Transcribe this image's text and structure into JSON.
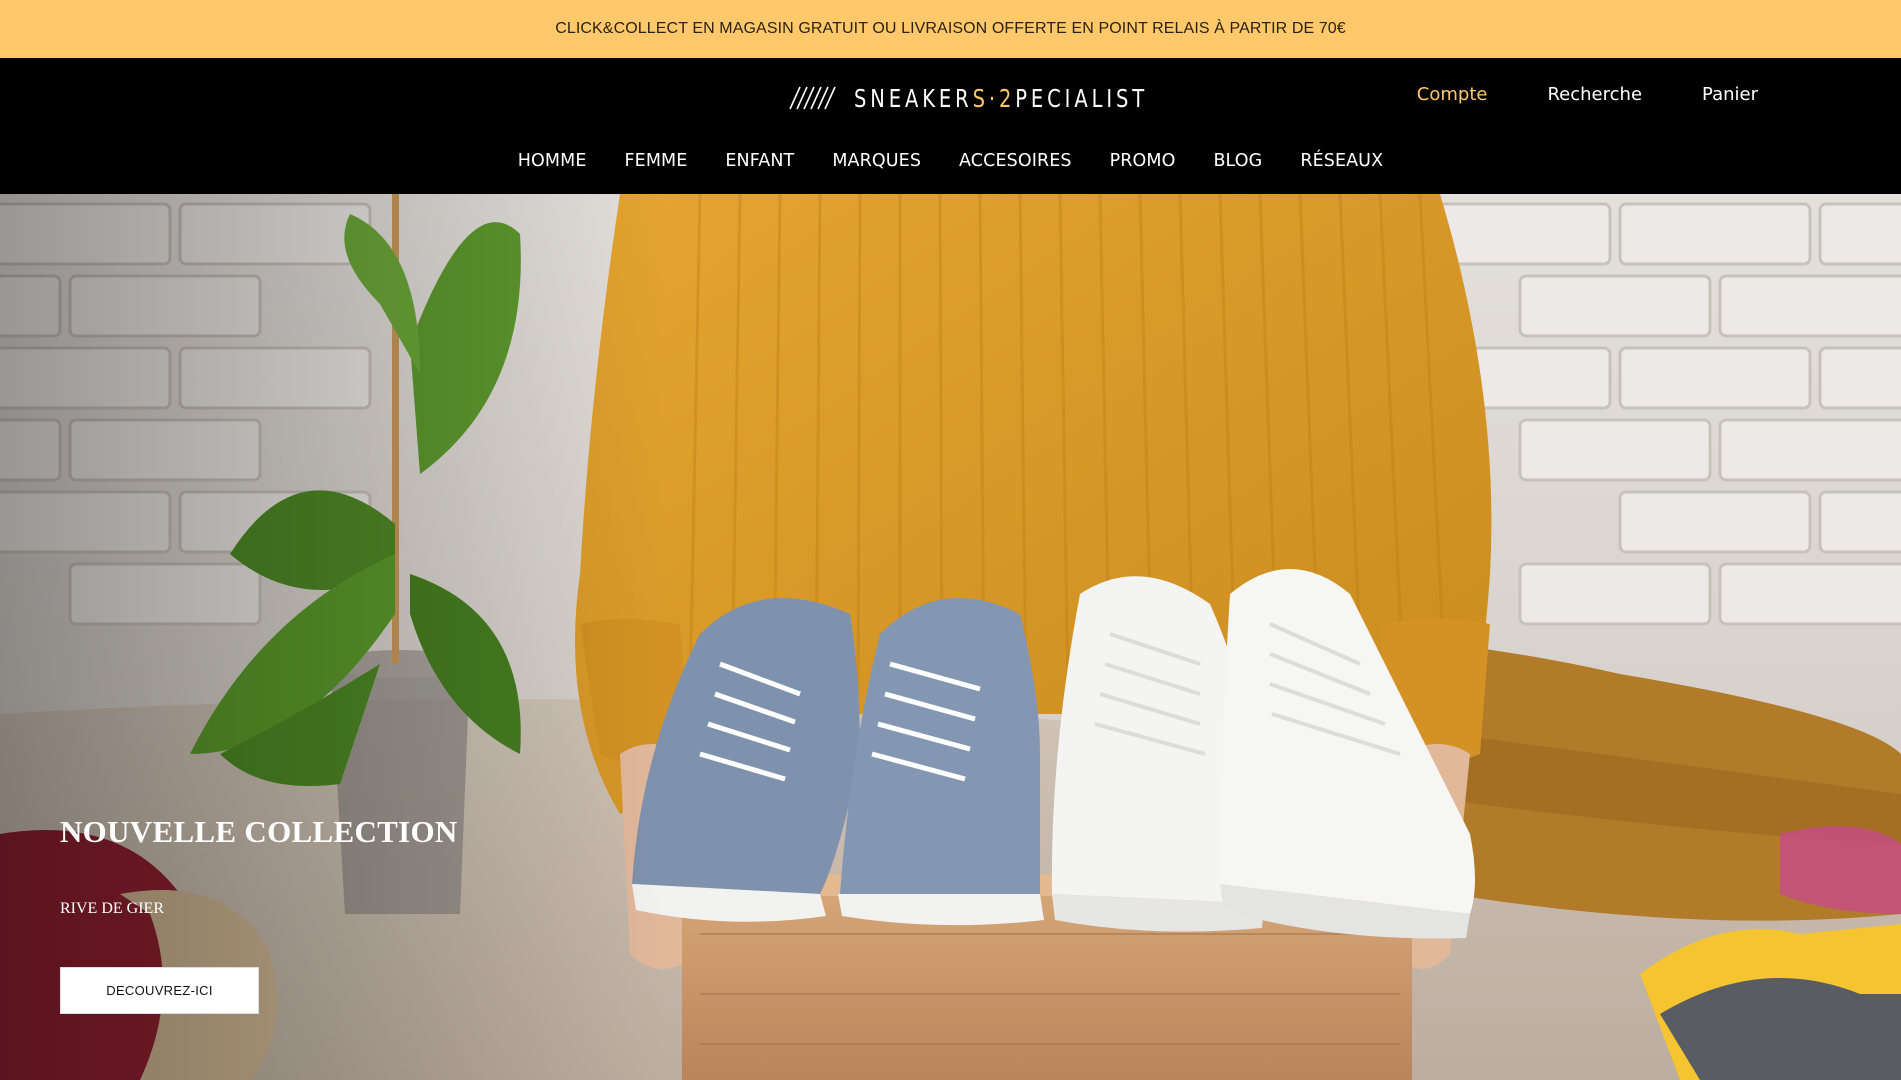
{
  "announcement": {
    "text": "CLICK&COLLECT EN MAGASIN GRATUIT OU LIVRAISON OFFERTE EN POINT RELAIS À PARTIR DE 70€"
  },
  "logo": {
    "text_main": "SNEAKER",
    "text_accent": "S·2",
    "text_end": "PECIALIST"
  },
  "account_links": [
    "Compte",
    "Recherche",
    "Panier"
  ],
  "nav": [
    "HOMME",
    "FEMME",
    "ENFANT",
    "MARQUES",
    "ACCESOIRES",
    "PROMO",
    "BLOG",
    "RÉSEAUX"
  ],
  "hero": {
    "title": "NOUVELLE COLLECTION",
    "subtitle": "RIVE DE GIER",
    "cta": "DECOUVREZ-ICI"
  },
  "colors": {
    "accent": "#ffc96b",
    "header_bg": "#000000"
  }
}
